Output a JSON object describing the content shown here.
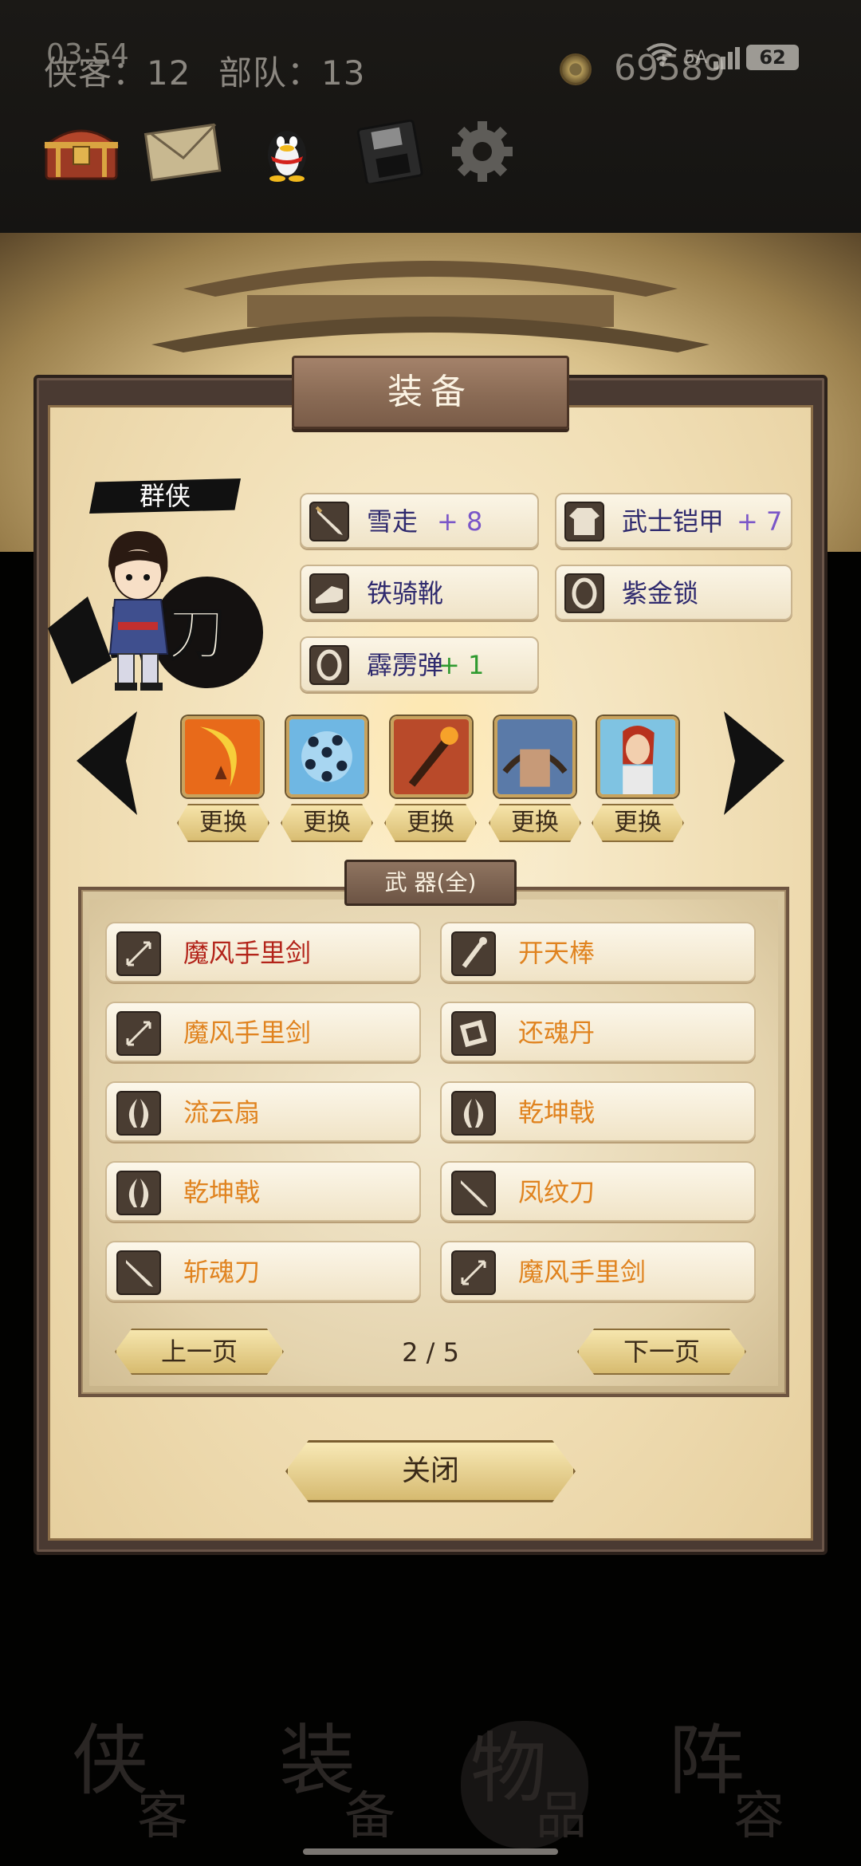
{
  "status_bar": {
    "time": "03:54",
    "network": "5A",
    "battery": "62"
  },
  "header": {
    "xiake_label": "侠客：12",
    "budui_label": "部队：13",
    "coins": "69589"
  },
  "toolbar": {
    "icons": [
      "treasure-chest-icon",
      "mail-icon",
      "qq-penguin-icon",
      "save-disk-icon",
      "settings-gear-icon"
    ]
  },
  "panel": {
    "title": "装备",
    "character": {
      "faction": "群侠",
      "emblem_text": "野刀"
    },
    "equipped": [
      {
        "name": "雪走",
        "bonus": "+ 8",
        "bonus_color": "#7a56c8",
        "icon": "blade-icon"
      },
      {
        "name": "武士铠甲",
        "bonus": "+ 7",
        "bonus_color": "#7a56c8",
        "icon": "armor-icon"
      },
      {
        "name": "铁骑靴",
        "bonus": "",
        "icon": "boot-icon"
      },
      {
        "name": "紫金锁",
        "bonus": "",
        "icon": "ring-icon"
      },
      {
        "name": "霹雳弹",
        "bonus": "+ 1",
        "bonus_color": "#2f9a2f",
        "icon": "ring-icon"
      }
    ],
    "skills": [
      {
        "name": "skill-crescent-slash",
        "swap_label": "更换"
      },
      {
        "name": "skill-ninja-swarm",
        "swap_label": "更换"
      },
      {
        "name": "skill-flaming-blade",
        "swap_label": "更换"
      },
      {
        "name": "skill-crossbow",
        "swap_label": "更换"
      },
      {
        "name": "skill-warrior-woman",
        "swap_label": "更换"
      }
    ],
    "inventory": {
      "category": "武 器(全)",
      "items": [
        {
          "name": "魔风手里剑",
          "color": "red",
          "icon": "shuriken-icon"
        },
        {
          "name": "开天棒",
          "color": "orange",
          "icon": "staff-icon"
        },
        {
          "name": "魔风手里剑",
          "color": "orange",
          "icon": "shuriken-icon"
        },
        {
          "name": "还魂丹",
          "color": "orange",
          "icon": "scroll-icon"
        },
        {
          "name": "流云扇",
          "color": "orange",
          "icon": "claw-icon"
        },
        {
          "name": "乾坤戟",
          "color": "orange",
          "icon": "claw-icon"
        },
        {
          "name": "乾坤戟",
          "color": "orange",
          "icon": "claw-icon"
        },
        {
          "name": "凤纹刀",
          "color": "orange",
          "icon": "blade-icon"
        },
        {
          "name": "斩魂刀",
          "color": "orange",
          "icon": "blade-icon"
        },
        {
          "name": "魔风手里剑",
          "color": "orange",
          "icon": "shuriken-icon"
        }
      ],
      "prev_page": "上一页",
      "next_page": "下一页",
      "page_indicator": "2 / 5"
    },
    "close_label": "关闭"
  },
  "bottom_nav": [
    {
      "glyph_main": "侠",
      "glyph_sub": "客"
    },
    {
      "glyph_main": "装",
      "glyph_sub": "备"
    },
    {
      "glyph_main": "物",
      "glyph_sub": "品"
    },
    {
      "glyph_main": "阵",
      "glyph_sub": "容"
    }
  ]
}
